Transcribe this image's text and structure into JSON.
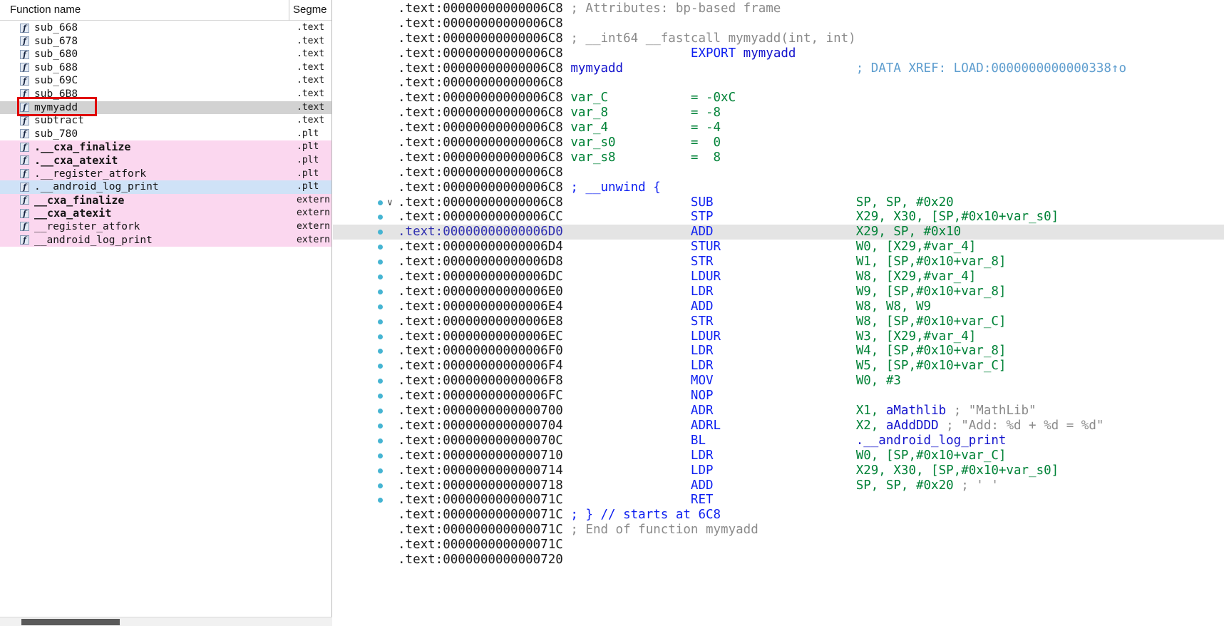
{
  "colors": {
    "addr": "#1c1c1c",
    "addr_selected": "#2f2fb0",
    "comment": "#8a8a8a",
    "keyword_blue": "#0d1ff0",
    "name_blue": "#1212cc",
    "operand_green": "#008237",
    "xref_blue": "#5f9ecf",
    "dot_teal": "#45b4d2",
    "line_highlight": "#e4e4e4",
    "selection_gray": "#d2d2d2",
    "row_pink": "#fbd7ef",
    "row_blue": "#cfe2f7",
    "red_box": "#e00000"
  },
  "functions_panel": {
    "header": {
      "name_col": "Function name",
      "segment_col": "Segme"
    },
    "rows": [
      {
        "name": "sub_668",
        "segment": ".text",
        "style": "normal"
      },
      {
        "name": "sub_678",
        "segment": ".text",
        "style": "normal"
      },
      {
        "name": "sub_680",
        "segment": ".text",
        "style": "normal"
      },
      {
        "name": "sub_688",
        "segment": ".text",
        "style": "normal"
      },
      {
        "name": "sub_69C",
        "segment": ".text",
        "style": "normal"
      },
      {
        "name": "sub_6B8",
        "segment": ".text",
        "style": "normal"
      },
      {
        "name": "mymyadd",
        "segment": ".text",
        "style": "selected",
        "red_box": true
      },
      {
        "name": "subtract",
        "segment": ".text",
        "style": "normal"
      },
      {
        "name": "sub_780",
        "segment": ".plt",
        "style": "normal"
      },
      {
        "name": ".__cxa_finalize",
        "segment": ".plt",
        "style": "pink",
        "bold": true
      },
      {
        "name": ".__cxa_atexit",
        "segment": ".plt",
        "style": "pink",
        "bold": true
      },
      {
        "name": ".__register_atfork",
        "segment": ".plt",
        "style": "pink"
      },
      {
        "name": ".__android_log_print",
        "segment": ".plt",
        "style": "blue"
      },
      {
        "name": "__cxa_finalize",
        "segment": "extern",
        "style": "pink",
        "bold": true
      },
      {
        "name": "__cxa_atexit",
        "segment": "extern",
        "style": "pink",
        "bold": true
      },
      {
        "name": "__register_atfork",
        "segment": "extern",
        "style": "pink"
      },
      {
        "name": "__android_log_print",
        "segment": "extern",
        "style": "pink"
      }
    ]
  },
  "disassembly": {
    "function_name": "mymyadd",
    "lines": [
      {
        "type": "cmt",
        "a": ".text:00000000000006C8",
        "cls": "c",
        "text": "; Attributes: bp-based frame"
      },
      {
        "type": "plain",
        "a": ".text:00000000000006C8"
      },
      {
        "type": "cmt",
        "a": ".text:00000000000006C8",
        "cls": "c",
        "text": "; __int64 __fastcall mymyadd(int, int)"
      },
      {
        "type": "ins",
        "a": ".text:00000000000006C8",
        "m": "EXPORT",
        "nopad": true,
        "ops": [
          [
            "n",
            "mymyadd"
          ]
        ]
      },
      {
        "type": "label",
        "a": ".text:00000000000006C8",
        "name": "mymyadd",
        "xref": "; DATA XREF: LOAD:0000000000000338↑o"
      },
      {
        "type": "plain",
        "a": ".text:00000000000006C8"
      },
      {
        "type": "var",
        "a": ".text:00000000000006C8",
        "name": "var_C",
        "val": "= -0xC"
      },
      {
        "type": "var",
        "a": ".text:00000000000006C8",
        "name": "var_8",
        "val": "= -8"
      },
      {
        "type": "var",
        "a": ".text:00000000000006C8",
        "name": "var_4",
        "val": "= -4"
      },
      {
        "type": "var",
        "a": ".text:00000000000006C8",
        "name": "var_s0",
        "val": "=  0"
      },
      {
        "type": "var",
        "a": ".text:00000000000006C8",
        "name": "var_s8",
        "val": "=  8"
      },
      {
        "type": "plain",
        "a": ".text:00000000000006C8"
      },
      {
        "type": "cmt",
        "a": ".text:00000000000006C8",
        "cls": "k",
        "text": "; __unwind {"
      },
      {
        "type": "ins",
        "a": ".text:00000000000006C8",
        "m": "SUB",
        "dot": true,
        "collapse": true,
        "ops": [
          [
            "g",
            "SP, SP, #0x20"
          ]
        ]
      },
      {
        "type": "ins",
        "a": ".text:00000000000006CC",
        "m": "STP",
        "dot": true,
        "ops": [
          [
            "g",
            "X29, X30, [SP,#0x10+var_s0]"
          ]
        ]
      },
      {
        "type": "ins",
        "a": ".text:00000000000006D0",
        "m": "ADD",
        "dot": true,
        "hl": true,
        "ops": [
          [
            "g",
            "X29, SP, #0x10"
          ]
        ]
      },
      {
        "type": "ins",
        "a": ".text:00000000000006D4",
        "m": "STUR",
        "dot": true,
        "ops": [
          [
            "g",
            "W0, [X29,#var_4]"
          ]
        ]
      },
      {
        "type": "ins",
        "a": ".text:00000000000006D8",
        "m": "STR",
        "dot": true,
        "ops": [
          [
            "g",
            "W1, [SP,#0x10+var_8]"
          ]
        ]
      },
      {
        "type": "ins",
        "a": ".text:00000000000006DC",
        "m": "LDUR",
        "dot": true,
        "ops": [
          [
            "g",
            "W8, [X29,#var_4]"
          ]
        ]
      },
      {
        "type": "ins",
        "a": ".text:00000000000006E0",
        "m": "LDR",
        "dot": true,
        "ops": [
          [
            "g",
            "W9, [SP,#0x10+var_8]"
          ]
        ]
      },
      {
        "type": "ins",
        "a": ".text:00000000000006E4",
        "m": "ADD",
        "dot": true,
        "ops": [
          [
            "g",
            "W8, W8, W9"
          ]
        ]
      },
      {
        "type": "ins",
        "a": ".text:00000000000006E8",
        "m": "STR",
        "dot": true,
        "ops": [
          [
            "g",
            "W8, [SP,#0x10+var_C]"
          ]
        ]
      },
      {
        "type": "ins",
        "a": ".text:00000000000006EC",
        "m": "LDUR",
        "dot": true,
        "ops": [
          [
            "g",
            "W3, [X29,#var_4]"
          ]
        ]
      },
      {
        "type": "ins",
        "a": ".text:00000000000006F0",
        "m": "LDR",
        "dot": true,
        "ops": [
          [
            "g",
            "W4, [SP,#0x10+var_8]"
          ]
        ]
      },
      {
        "type": "ins",
        "a": ".text:00000000000006F4",
        "m": "LDR",
        "dot": true,
        "ops": [
          [
            "g",
            "W5, [SP,#0x10+var_C]"
          ]
        ]
      },
      {
        "type": "ins",
        "a": ".text:00000000000006F8",
        "m": "MOV",
        "dot": true,
        "ops": [
          [
            "g",
            "W0, #3"
          ]
        ]
      },
      {
        "type": "ins",
        "a": ".text:00000000000006FC",
        "m": "NOP",
        "dot": true,
        "ops": []
      },
      {
        "type": "ins",
        "a": ".text:0000000000000700",
        "m": "ADR",
        "dot": true,
        "ops": [
          [
            "g",
            "X1, "
          ],
          [
            "n",
            "aMathlib"
          ],
          [
            "c",
            " ; \"MathLib\""
          ]
        ]
      },
      {
        "type": "ins",
        "a": ".text:0000000000000704",
        "m": "ADRL",
        "dot": true,
        "ops": [
          [
            "g",
            "X2, "
          ],
          [
            "n",
            "aAddDDD"
          ],
          [
            "c",
            " ; \"Add: %d + %d = %d\""
          ]
        ]
      },
      {
        "type": "ins",
        "a": ".text:000000000000070C",
        "m": "BL",
        "dot": true,
        "ops": [
          [
            "n",
            ".__android_log_print"
          ]
        ]
      },
      {
        "type": "ins",
        "a": ".text:0000000000000710",
        "m": "LDR",
        "dot": true,
        "ops": [
          [
            "g",
            "W0, [SP,#0x10+var_C]"
          ]
        ]
      },
      {
        "type": "ins",
        "a": ".text:0000000000000714",
        "m": "LDP",
        "dot": true,
        "ops": [
          [
            "g",
            "X29, X30, [SP,#0x10+var_s0]"
          ]
        ]
      },
      {
        "type": "ins",
        "a": ".text:0000000000000718",
        "m": "ADD",
        "dot": true,
        "ops": [
          [
            "g",
            "SP, SP, #0x20"
          ],
          [
            "c",
            " ; ' '"
          ]
        ]
      },
      {
        "type": "ins",
        "a": ".text:000000000000071C",
        "m": "RET",
        "dot": true,
        "ops": []
      },
      {
        "type": "cmt",
        "a": ".text:000000000000071C",
        "cls": "k",
        "text": "; } // starts at 6C8"
      },
      {
        "type": "cmt",
        "a": ".text:000000000000071C",
        "cls": "c",
        "text": "; End of function mymyadd"
      },
      {
        "type": "plain",
        "a": ".text:000000000000071C"
      },
      {
        "type": "plain",
        "a": ".text:0000000000000720"
      }
    ]
  }
}
